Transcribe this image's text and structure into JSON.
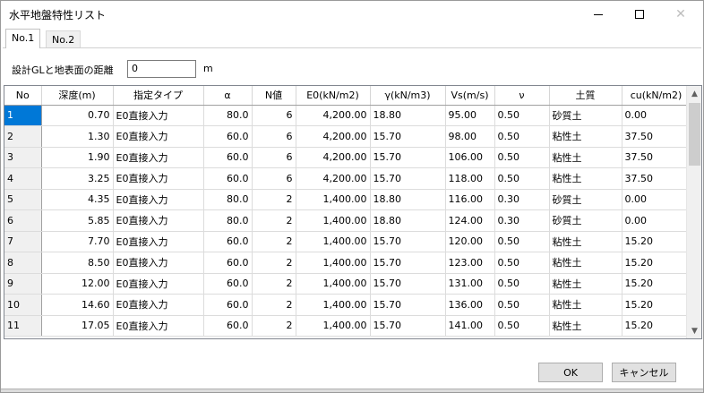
{
  "window": {
    "title": "水平地盤特性リスト"
  },
  "tabs": [
    {
      "label": "No.1",
      "active": true
    },
    {
      "label": "No.2",
      "active": false
    }
  ],
  "distance": {
    "label": "設計GLと地表面の距離",
    "value": "0",
    "unit": "m"
  },
  "table": {
    "headers": [
      "No",
      "深度(m)",
      "指定タイプ",
      "α",
      "N値",
      "E0(kN/m2)",
      "γ(kN/m3)",
      "Vs(m/s)",
      "ν",
      "土質",
      "cu(kN/m2)"
    ],
    "rows": [
      [
        "1",
        "0.70",
        "E0直接入力",
        "80.0",
        "6",
        "4,200.00",
        "18.80",
        "95.00",
        "0.50",
        "砂質土",
        "0.00"
      ],
      [
        "2",
        "1.30",
        "E0直接入力",
        "60.0",
        "6",
        "4,200.00",
        "15.70",
        "98.00",
        "0.50",
        "粘性土",
        "37.50"
      ],
      [
        "3",
        "1.90",
        "E0直接入力",
        "60.0",
        "6",
        "4,200.00",
        "15.70",
        "106.00",
        "0.50",
        "粘性土",
        "37.50"
      ],
      [
        "4",
        "3.25",
        "E0直接入力",
        "60.0",
        "6",
        "4,200.00",
        "15.70",
        "118.00",
        "0.50",
        "粘性土",
        "37.50"
      ],
      [
        "5",
        "4.35",
        "E0直接入力",
        "80.0",
        "2",
        "1,400.00",
        "18.80",
        "116.00",
        "0.30",
        "砂質土",
        "0.00"
      ],
      [
        "6",
        "5.85",
        "E0直接入力",
        "80.0",
        "2",
        "1,400.00",
        "18.80",
        "124.00",
        "0.30",
        "砂質土",
        "0.00"
      ],
      [
        "7",
        "7.70",
        "E0直接入力",
        "60.0",
        "2",
        "1,400.00",
        "15.70",
        "120.00",
        "0.50",
        "粘性土",
        "15.20"
      ],
      [
        "8",
        "8.50",
        "E0直接入力",
        "60.0",
        "2",
        "1,400.00",
        "15.70",
        "123.00",
        "0.50",
        "粘性土",
        "15.20"
      ],
      [
        "9",
        "12.00",
        "E0直接入力",
        "60.0",
        "2",
        "1,400.00",
        "15.70",
        "131.00",
        "0.50",
        "粘性土",
        "15.20"
      ],
      [
        "10",
        "14.60",
        "E0直接入力",
        "60.0",
        "2",
        "1,400.00",
        "15.70",
        "136.00",
        "0.50",
        "粘性土",
        "15.20"
      ],
      [
        "11",
        "17.05",
        "E0直接入力",
        "60.0",
        "2",
        "1,400.00",
        "15.70",
        "141.00",
        "0.50",
        "粘性土",
        "15.20"
      ]
    ]
  },
  "buttons": {
    "ok": "OK",
    "cancel": "キャンセル"
  },
  "icons": {
    "minimize": "minimize-icon",
    "maximize": "maximize-icon",
    "close": "close-icon",
    "scroll_up": "chevron-up-icon",
    "scroll_down": "chevron-down-icon"
  },
  "colors": {
    "selection": "#0078d7",
    "button_face": "#e1e1e1"
  }
}
